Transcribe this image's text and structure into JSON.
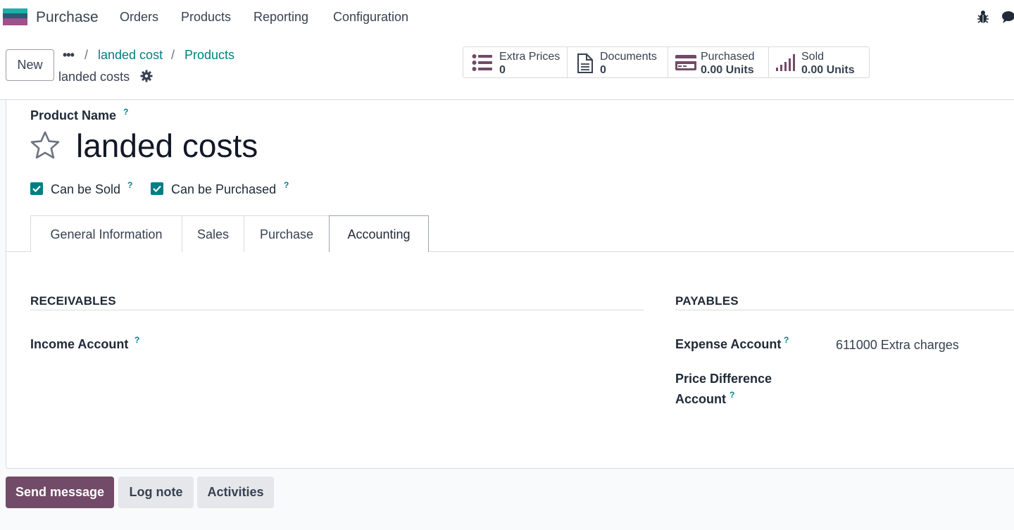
{
  "navbar": {
    "app_name": "Purchase",
    "menus": [
      "Orders",
      "Products",
      "Reporting",
      "Configuration"
    ],
    "icons": [
      "bug-icon",
      "chat-icon"
    ]
  },
  "control_panel": {
    "new_label": "New",
    "breadcrumb_more": "•••",
    "breadcrumbs": [
      "landed cost",
      "Products"
    ],
    "breadcrumb_sep": "/",
    "record_name": "landed costs",
    "stats": [
      {
        "label": "Extra Prices",
        "value": "0",
        "icon": "list-icon"
      },
      {
        "label": "Documents",
        "value": "0",
        "icon": "document-icon"
      },
      {
        "label": "Purchased",
        "value": "0.00 Units",
        "icon": "credit-card-icon"
      },
      {
        "label": "Sold",
        "value": "0.00 Units",
        "icon": "signal-bars-icon"
      }
    ]
  },
  "form": {
    "product_name_label": "Product Name",
    "help_mark": "?",
    "product_name": "landed costs",
    "can_be_sold_label": "Can be Sold",
    "can_be_sold": true,
    "can_be_purchased_label": "Can be Purchased",
    "can_be_purchased": true,
    "tabs": [
      "General Information",
      "Sales",
      "Purchase",
      "Accounting"
    ],
    "active_tab": "Accounting",
    "receivables": {
      "title": "RECEIVABLES",
      "income_account_label": "Income Account",
      "income_account_value": ""
    },
    "payables": {
      "title": "PAYABLES",
      "expense_account_label": "Expense Account",
      "expense_account_value": "611000 Extra charges",
      "price_diff_label_1": "Price Difference",
      "price_diff_label_2": "Account",
      "price_diff_value": ""
    }
  },
  "chatter": {
    "send_message": "Send message",
    "log_note": "Log note",
    "activities": "Activities"
  },
  "colors": {
    "accent": "#017e84",
    "brand": "#714b67"
  }
}
